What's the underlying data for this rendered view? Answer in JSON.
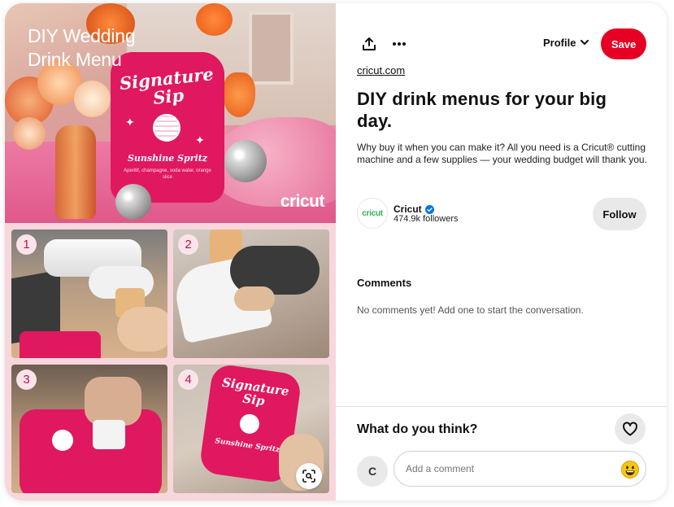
{
  "image": {
    "title_line1": "DIY Wedding",
    "title_line2": "Drink Menu",
    "watermark": "cricut",
    "sign_title_line1": "Signature",
    "sign_title_line2": "Sip",
    "sign_drink_name": "Sunshine Spritz",
    "sign_ingredients": "Aperitif, champagne, soda water, orange slice",
    "steps": [
      "1",
      "2",
      "3",
      "4"
    ],
    "step4_sign_line1": "Signature",
    "step4_sign_line2": "Sip",
    "step4_drink": "Sunshine Spritz"
  },
  "toolbar": {
    "profile_label": "Profile",
    "save_label": "Save"
  },
  "pin": {
    "source": "cricut.com",
    "title": "DIY drink menus for your big day.",
    "description": "Why buy it when you can make it? All you need is a Cricut® cutting machine and a few supplies — your wedding budget will thank you."
  },
  "creator": {
    "avatar_text": "cricut",
    "name": "Cricut",
    "followers": "474.9k followers",
    "follow_label": "Follow"
  },
  "comments": {
    "heading": "Comments",
    "empty_text": "No comments yet! Add one to start the conversation."
  },
  "footer": {
    "prompt": "What do you think?",
    "user_initial": "C",
    "input_placeholder": "Add a comment"
  },
  "colors": {
    "save": "#e60023",
    "verified": "#0074e8",
    "brand_green": "#2fb24c",
    "pink_bg": "#f7d6dc"
  }
}
